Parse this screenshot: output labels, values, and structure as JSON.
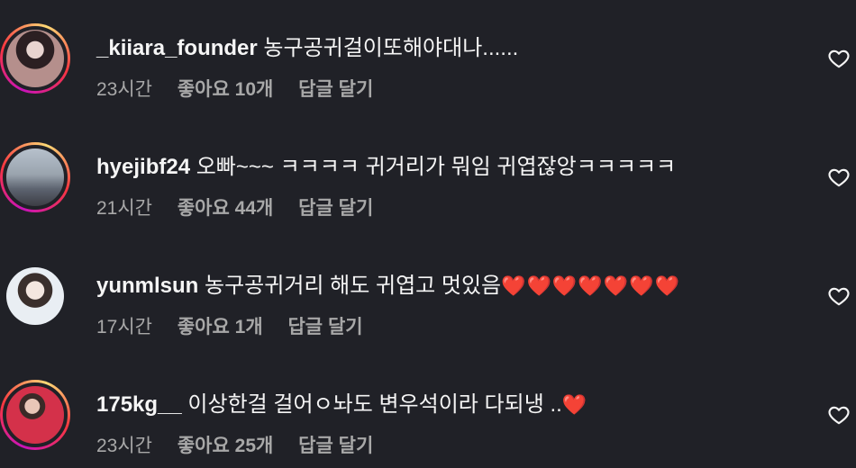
{
  "comments": [
    {
      "username": "_kiiara_founder",
      "text": "농구공귀걸이또해야대나......",
      "hearts": "",
      "time": "23시간",
      "likes": "좋아요 10개",
      "reply": "답글 달기"
    },
    {
      "username": "hyejibf24",
      "text": "오빠~~~ ㅋㅋㅋㅋ 귀거리가 뭐임 귀엽잖앙ㅋㅋㅋㅋㅋ",
      "hearts": "",
      "time": "21시간",
      "likes": "좋아요 44개",
      "reply": "답글 달기"
    },
    {
      "username": "yunmlsun",
      "text": "농구공귀거리 해도 귀엽고 멋있음",
      "hearts": "❤️❤️❤️❤️❤️❤️❤️",
      "time": "17시간",
      "likes": "좋아요 1개",
      "reply": "답글 달기"
    },
    {
      "username": "175kg__",
      "text": "이상한걸 걸어ㅇ놔도 변우석이라 다되냉 ..",
      "hearts": "❤️",
      "time": "23시간",
      "likes": "좋아요 25개",
      "reply": "답글 달기"
    }
  ],
  "icons": {
    "like": "heart-outline-icon"
  },
  "colors": {
    "background": "#202127",
    "text": "#f5f5f5",
    "meta": "#a8a8a8",
    "story_ring": [
      "#c913b9",
      "#f9373f",
      "#feda75"
    ],
    "heart_emoji": "#ff2d55"
  }
}
